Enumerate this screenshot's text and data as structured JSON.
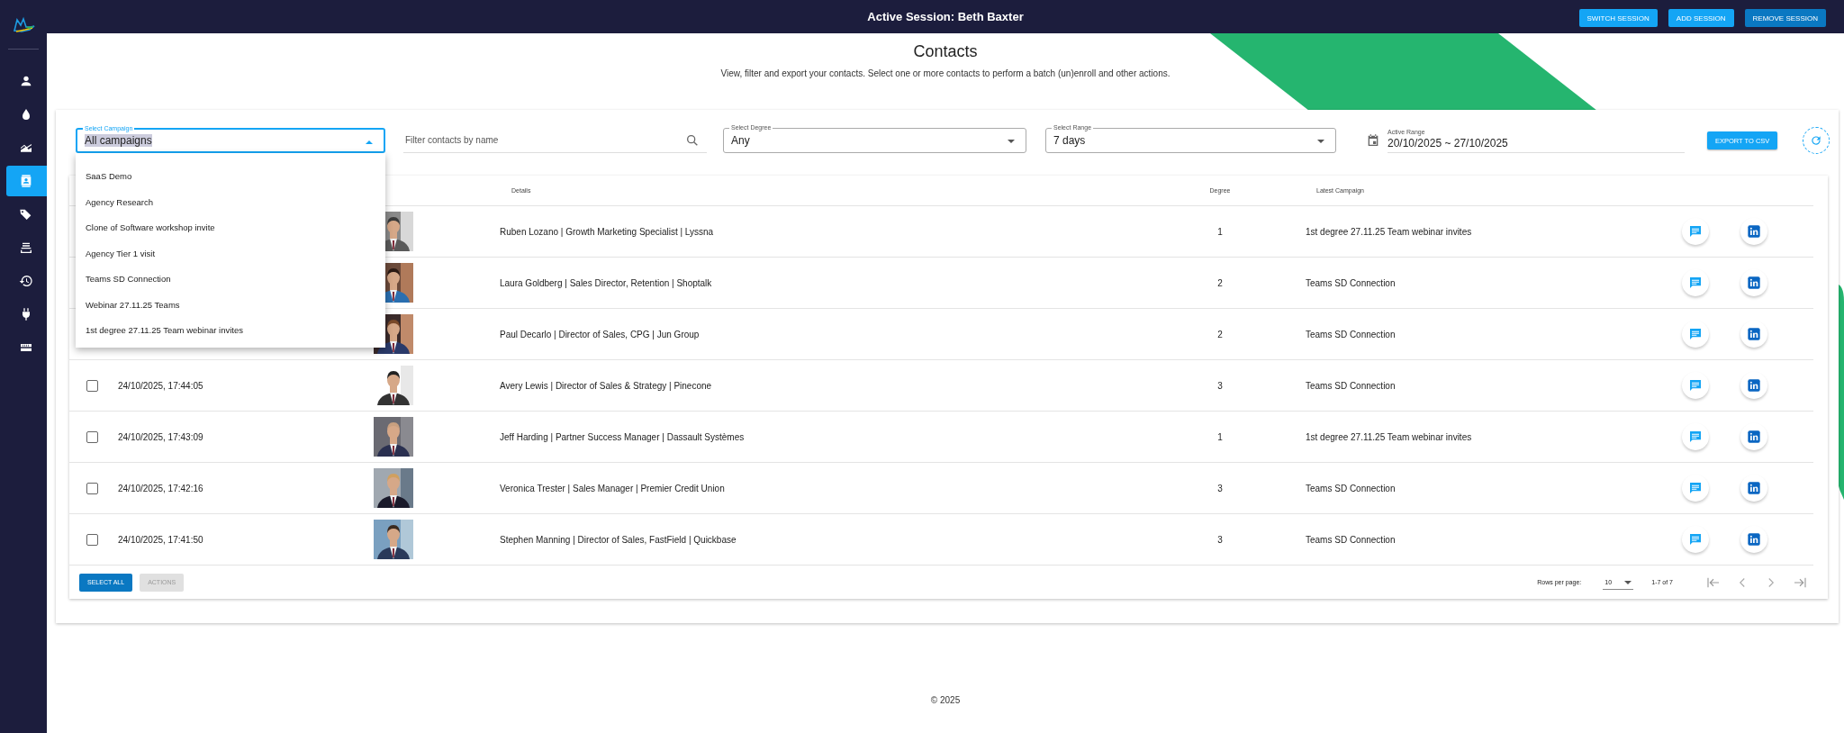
{
  "sidebar": {
    "items": [
      {
        "kind": "person",
        "selected": false
      },
      {
        "kind": "drop",
        "selected": false
      },
      {
        "kind": "chart",
        "selected": false
      },
      {
        "kind": "contacts",
        "selected": true
      },
      {
        "kind": "tags",
        "selected": false
      },
      {
        "kind": "list",
        "selected": false
      },
      {
        "kind": "history",
        "selected": false
      },
      {
        "kind": "plug",
        "selected": false
      },
      {
        "kind": "server",
        "selected": false
      }
    ]
  },
  "top_bar": {
    "title": "Active Session: Beth Baxter",
    "buttons": [
      {
        "label": "SWITCH SESSION",
        "kind": "light"
      },
      {
        "label": "ADD SESSION",
        "kind": "light"
      },
      {
        "label": "REMOVE SESSION",
        "kind": "dark"
      }
    ]
  },
  "header": {
    "title": "Contacts",
    "subtitle": "View, filter and export your contacts. Select one or more contacts to perform a batch (un)enroll and other actions."
  },
  "filters": {
    "campaign": {
      "label": "Select Campaign",
      "value": "All campaigns",
      "expanded": true,
      "options": [
        {
          "label": "SaaS Demo",
          "selected": false
        },
        {
          "label": "Agency Research",
          "selected": false
        },
        {
          "label": "Clone of Software workshop invite",
          "selected": false
        },
        {
          "label": "Agency Tier 1 visit",
          "selected": false
        },
        {
          "label": "Teams SD Connection",
          "selected": false
        },
        {
          "label": "Webinar 27.11.25 Teams",
          "selected": false
        },
        {
          "label": "1st degree 27.11.25 Team webinar invites",
          "selected": false
        }
      ]
    },
    "search": {
      "placeholder": "Filter contacts by name"
    },
    "degree": {
      "label": "Select Degree",
      "value": "Any"
    },
    "range": {
      "label": "Select Range",
      "value": "7 days"
    },
    "active_range": {
      "label": "Active Range",
      "value": "20/10/2025 ~ 27/10/2025"
    },
    "export_button": "EXPORT TO CSV"
  },
  "table": {
    "columns": [
      "Details",
      "Degree",
      "Latest Campaign"
    ],
    "rows": [
      {
        "details": "Ruben Lozano | Growth Marketing Specialist  | Lyssna",
        "degree": "1",
        "campaign": "1st degree 27.11.25 Team webinar invites"
      },
      {
        "details": "Laura Goldberg | Sales Director, Retention  | Shoptalk",
        "degree": "2",
        "campaign": "Teams SD Connection"
      },
      {
        "details": "Paul Decarlo | Director of Sales, CPG  | Jun Group",
        "degree": "2",
        "campaign": "Teams SD Connection"
      },
      {
        "checked": false,
        "date": "24/10/2025, 17:44:05",
        "details": "Avery Lewis | Director of Sales & Strategy  | Pinecone",
        "degree": "3",
        "campaign": "Teams SD Connection"
      },
      {
        "checked": false,
        "date": "24/10/2025, 17:43:09",
        "details": "Jeff Harding | Partner Success Manager  | Dassault Systèmes",
        "degree": "1",
        "campaign": "1st degree 27.11.25 Team webinar invites"
      },
      {
        "checked": false,
        "date": "24/10/2025, 17:42:16",
        "details": "Veronica Trester | Sales Manager  | Premier Credit Union",
        "degree": "3",
        "campaign": "Teams SD Connection"
      },
      {
        "checked": false,
        "date": "24/10/2025, 17:41:50",
        "details": "Stephen Manning | Director of Sales, FastField  | Quickbase",
        "degree": "3",
        "campaign": "Teams SD Connection"
      }
    ]
  },
  "footer": {
    "select_all": "SELECT ALL",
    "actions": {
      "label": "ACTIONS",
      "disabled": true
    },
    "rows_per_page_label": "Rows per page:",
    "rows_per_page": "10",
    "range": "1-7 of 7"
  },
  "copyright": "© 2025"
}
